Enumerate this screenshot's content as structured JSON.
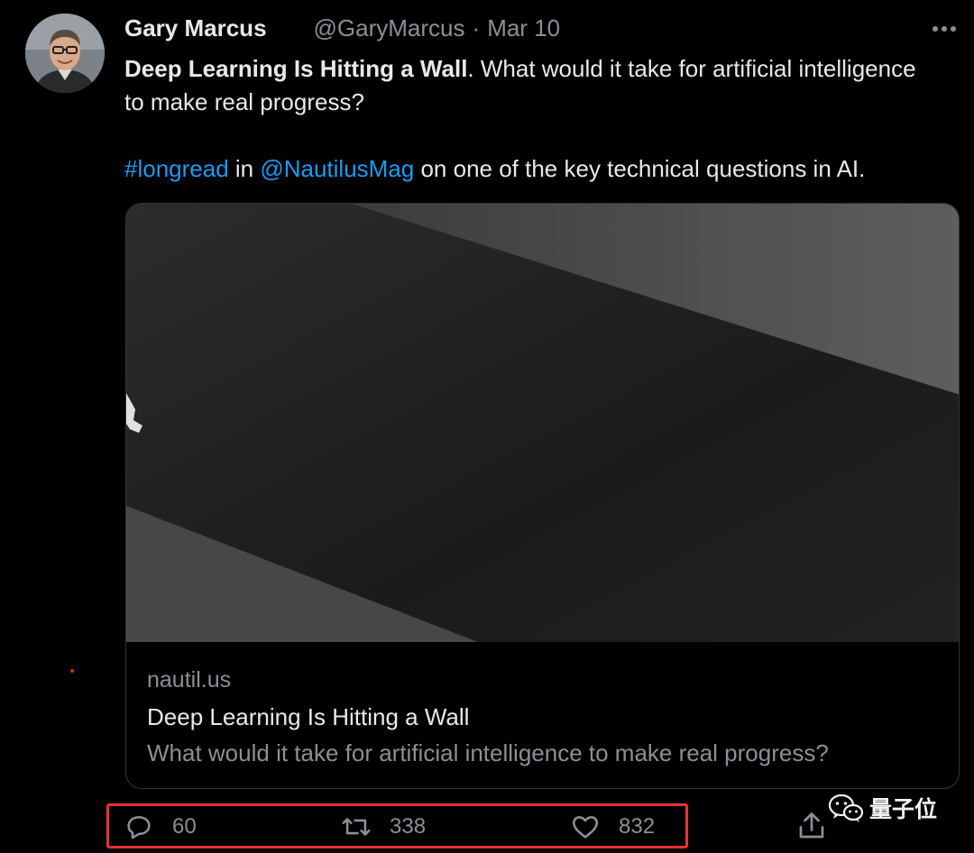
{
  "tweet": {
    "author_name": "Gary Marcus",
    "author_handle": "@GaryMarcus",
    "separator": "·",
    "date": "Mar 10",
    "text_bold": "Deep Learning Is Hitting a Wall",
    "text_rest": ". What would it take for artificial intelligence to make real progress?",
    "hashtag": "#longread",
    "in_word": " in ",
    "mention": "@NautilusMag",
    "text_tail": " on one of the key technical questions in AI."
  },
  "card": {
    "domain": "nautil.us",
    "title": "Deep Learning Is Hitting a Wall",
    "description": "What would it take for artificial intelligence to make real progress?"
  },
  "actions": {
    "replies": "60",
    "retweets": "338",
    "likes": "832"
  },
  "watermark": {
    "text": "量子位",
    "icon": "wechat-icon"
  },
  "icons": {
    "more": "more-icon",
    "reply": "reply-icon",
    "retweet": "retweet-icon",
    "like": "heart-icon",
    "share": "share-icon"
  },
  "colors": {
    "background": "#000000",
    "text": "#e7e9ea",
    "secondary": "#8b9096",
    "link": "#1d9bf0",
    "highlight_box": "#e63333"
  }
}
